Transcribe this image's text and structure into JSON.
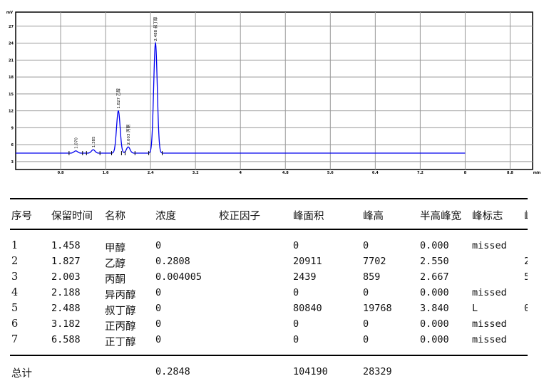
{
  "chart_data": {
    "type": "line",
    "xlabel": "min",
    "ylabel": "mV",
    "xlim": [
      0,
      9.2
    ],
    "ylim": [
      1.6,
      29.5
    ],
    "xticks": [
      "0.8",
      "1.6",
      "2.4",
      "3.2",
      "4",
      "4.8",
      "5.6",
      "6.4",
      "7.2",
      "8",
      "8.8"
    ],
    "yticks": [
      "3",
      "6",
      "9",
      "12",
      "15",
      "18",
      "21",
      "24",
      "27"
    ],
    "grid": true,
    "line_color": "#0000ee",
    "baseline": 4.5,
    "x_end": 8.0,
    "peaks": [
      {
        "rt": 1.07,
        "height": 0.4,
        "label": "1.070"
      },
      {
        "rt": 1.38,
        "height": 0.6,
        "label": "1.385"
      },
      {
        "rt": 1.827,
        "height": 7.5,
        "label": "1.827 乙醇"
      },
      {
        "rt": 2.003,
        "height": 1.1,
        "label": "2.003 丙酮"
      },
      {
        "rt": 2.488,
        "height": 19.5,
        "label": "2.488 叔丁醇"
      }
    ]
  },
  "table": {
    "headers": [
      "序号",
      "保留时间",
      "名称",
      "浓度",
      "校正因子",
      "峰面积",
      "峰高",
      "半高峰宽",
      "峰标志",
      "峰"
    ],
    "rows": [
      [
        "1",
        "1.458",
        "甲醇",
        "0",
        "",
        "0",
        "0",
        "0.000",
        "missed",
        ""
      ],
      [
        "2",
        "1.827",
        "乙醇",
        "0.2808",
        "",
        "20911",
        "7702",
        "2.550",
        "",
        "2"
      ],
      [
        "3",
        "2.003",
        "丙酮",
        "0.004005",
        "",
        "2439",
        "859",
        "2.667",
        "",
        "5"
      ],
      [
        "4",
        "2.188",
        "异丙醇",
        "0",
        "",
        "0",
        "0",
        "0.000",
        "missed",
        ""
      ],
      [
        "5",
        "2.488",
        "叔丁醇",
        "0",
        "",
        "80840",
        "19768",
        "3.840",
        "L",
        "0"
      ],
      [
        "6",
        "3.182",
        "正丙醇",
        "0",
        "",
        "0",
        "0",
        "0.000",
        "missed",
        ""
      ],
      [
        "7",
        "6.588",
        "正丁醇",
        "0",
        "",
        "0",
        "0",
        "0.000",
        "missed",
        ""
      ]
    ],
    "total": {
      "label": "总计",
      "concentration": "0.2848",
      "area": "104190",
      "height": "28329"
    }
  }
}
